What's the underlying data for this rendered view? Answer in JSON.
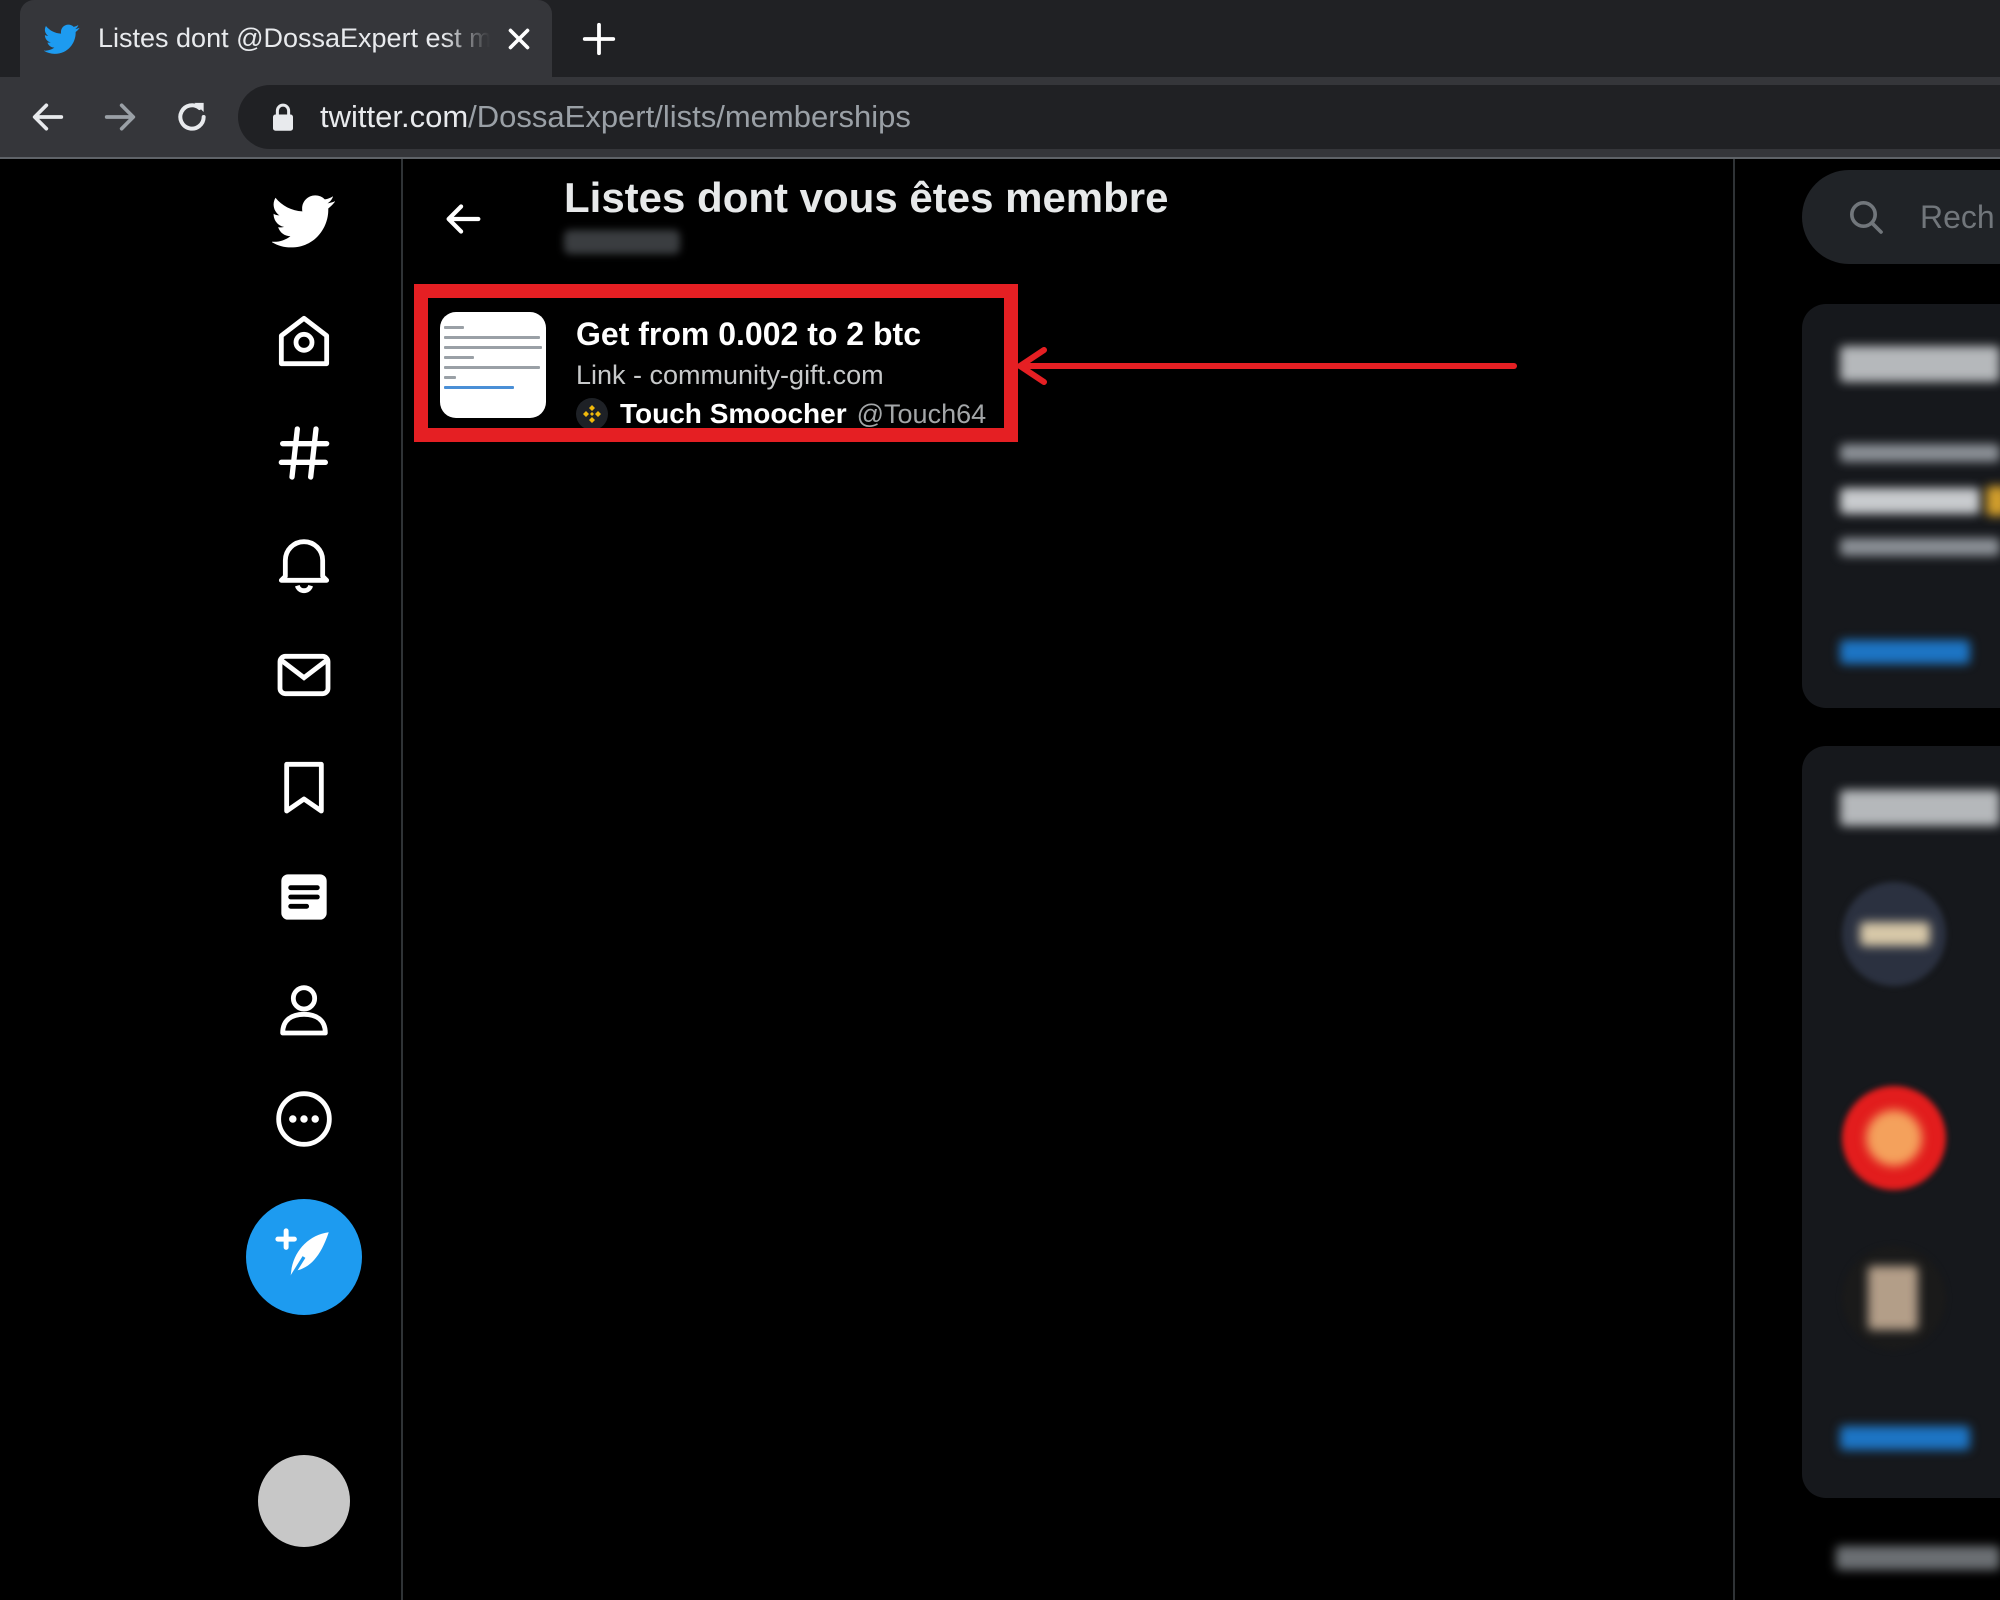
{
  "browser": {
    "tab": {
      "title": "Listes dont @DossaExpert est membre",
      "favicon": "twitter-bird-icon",
      "close_icon": "close-icon"
    },
    "new_tab_icon": "plus-icon",
    "url_host": "twitter.com",
    "url_path": "/DossaExpert/lists/memberships"
  },
  "nav": {
    "icons": [
      "twitter-logo-icon",
      "home-icon",
      "explore-hashtag-icon",
      "notifications-bell-icon",
      "messages-envelope-icon",
      "bookmark-icon",
      "lists-icon",
      "profile-icon",
      "more-icon"
    ],
    "compose_icon": "compose-tweet-icon"
  },
  "page": {
    "title": "Listes dont vous êtes membre"
  },
  "list": {
    "title": "Get from 0.002 to 2 btc",
    "description": "Link - community-gift.com",
    "owner_name": "Touch Smoocher",
    "owner_handle": "@Touch64"
  },
  "sidebar": {
    "search_placeholder": "Rech"
  },
  "colors": {
    "accent": "#1d9bf0",
    "highlight": "#e51f23",
    "background": "#000000"
  }
}
